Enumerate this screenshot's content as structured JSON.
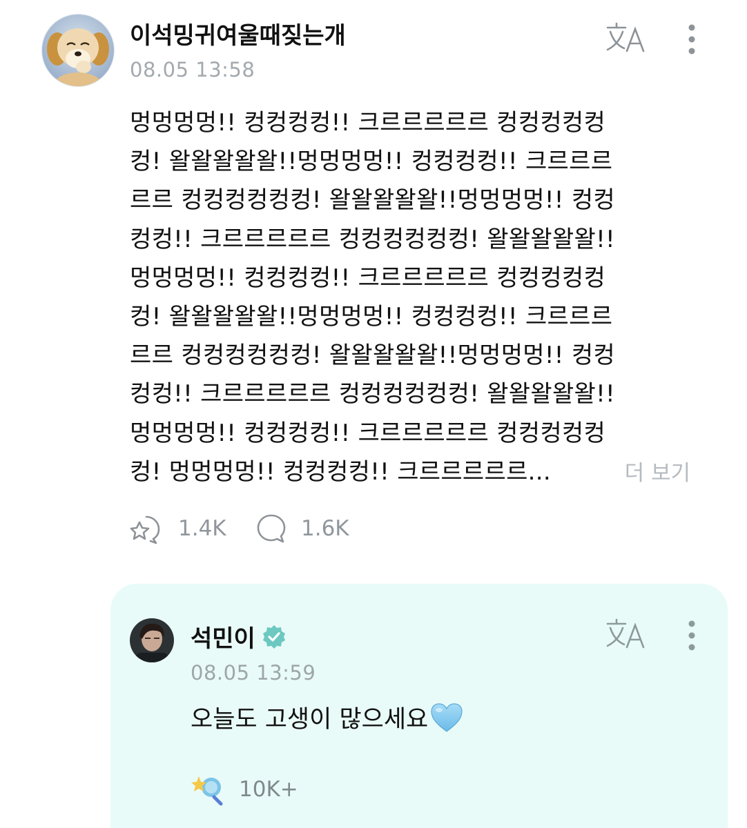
{
  "post": {
    "author": "이석밍귀여울때짖는개",
    "timestamp": "08.05 13:58",
    "body": " 멍멍멍멍!! 컹컹컹컹!! 크르르르르르 컹컹컹컹컹\n컹! 왈왈왈왈왈!!멍멍멍멍!! 컹컹컹컹!! 크르르르\n르르 컹컹컹컹컹컹! 왈왈왈왈왈!!멍멍멍멍!! 컹컹\n컹컹!! 크르르르르르 컹컹컹컹컹컹! 왈왈왈왈왈!!\n멍멍멍멍!! 컹컹컹컹!! 크르르르르르 컹컹컹컹컹\n컹! 왈왈왈왈왈!!멍멍멍멍!! 컹컹컹컹!! 크르르르\n르르 컹컹컹컹컹컹! 왈왈왈왈왈!!멍멍멍멍!! 컹컹\n컹컹!! 크르르르르르 컹컹컹컹컹컹! 왈왈왈왈왈!!\n멍멍멍멍!! 컹컹컹컹!! 크르르르르르 컹컹컹컹컹\n컹! 멍멍멍멍!! 컹컹컹컹!! 크르르르르르...",
    "see_more": "더 보기",
    "reactions_count": "1.4K",
    "comments_count": "1.6K"
  },
  "reply": {
    "author": "석민이",
    "timestamp": "08.05 13:59",
    "text": "오늘도 고생이 많으세요",
    "reactions_count": "10K+"
  },
  "colors": {
    "reply_card_bg": "#e9fbf8",
    "verified_badge": "#6cc9c1",
    "timestamp_gray": "#a3a9ae",
    "heart_blue": "#7fc8f0"
  },
  "icons": {
    "translate": "translate-icon",
    "more": "more-vertical-icon",
    "reaction": "reaction-icon",
    "comment": "comment-icon",
    "verified": "verified-badge-icon",
    "heart": "light-blue-heart-emoji",
    "artist_reaction": "artist-reaction-icon"
  }
}
